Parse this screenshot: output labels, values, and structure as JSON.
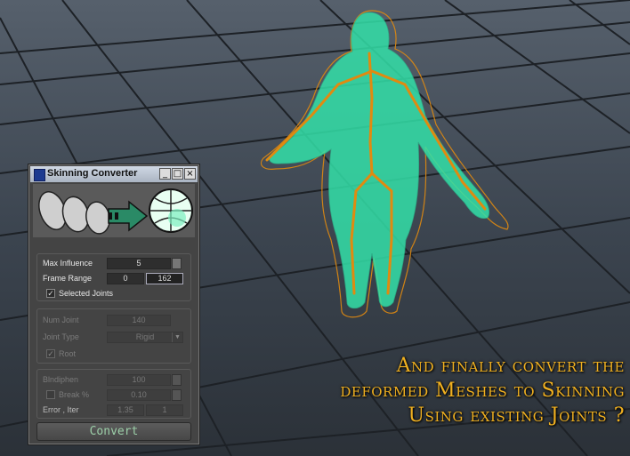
{
  "caption": {
    "line1": "And finally convert the",
    "line2": "deformed Meshes to Skinning",
    "line3": "Using existing Joints ?"
  },
  "window": {
    "title": "Skinning Converter",
    "minimize_glyph": "_",
    "maximize_glyph": "□",
    "close_glyph": "×"
  },
  "group1": {
    "max_influence_label": "Max Influence",
    "max_influence_value": "5",
    "frame_range_label": "Frame Range",
    "frame_start": "0",
    "frame_end": "162",
    "selected_joints_label": "Selected Joints",
    "selected_joints_checked": "✓"
  },
  "group2": {
    "num_joint_label": "Num Joint",
    "num_joint_value": "140",
    "joint_type_label": "Joint Type",
    "joint_type_value": "Rigid",
    "root_label": "Root",
    "root_checked": "✓"
  },
  "group3": {
    "bindiphen_label": "Blndiphen",
    "bindiphen_value": "100",
    "break_label": "Break %",
    "break_value": "0.10",
    "error_iter_label": "Error , Iter",
    "error_value": "1.35",
    "iter_value": "1"
  },
  "convert_label": "Convert",
  "colors": {
    "mesh": "#33e0a8",
    "joints": "#e08a10",
    "caption": "#f0b020",
    "grid": "#1e2228"
  }
}
